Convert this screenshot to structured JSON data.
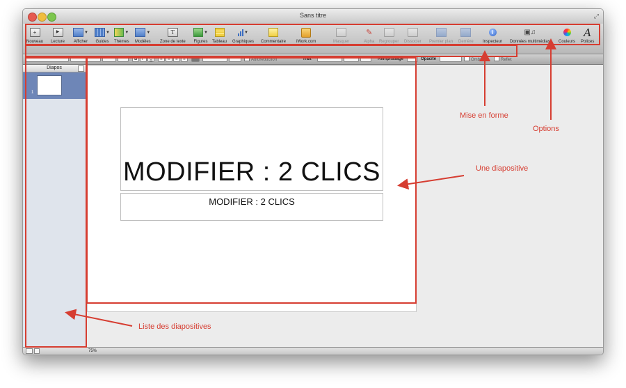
{
  "window": {
    "title": "Sans titre"
  },
  "toolbar": {
    "items": [
      {
        "label": "Nouveau",
        "icon": "plus-icon",
        "glyph": "+"
      },
      {
        "label": "Lecture",
        "icon": "play-icon",
        "glyph": "▶"
      },
      {
        "label": "Afficher",
        "icon": "view-icon"
      },
      {
        "label": "Guides",
        "icon": "guides-icon"
      },
      {
        "label": "Thèmes",
        "icon": "themes-icon"
      },
      {
        "label": "Modèles",
        "icon": "templates-icon"
      },
      {
        "label": "Zone de texte",
        "icon": "textbox-icon",
        "glyph": "T"
      },
      {
        "label": "Figures",
        "icon": "shapes-icon"
      },
      {
        "label": "Tableau",
        "icon": "table-icon"
      },
      {
        "label": "Graphiques",
        "icon": "chart-icon"
      },
      {
        "label": "Commentaire",
        "icon": "comment-icon"
      },
      {
        "label": "iWork.com",
        "icon": "iwork-icon"
      },
      {
        "label": "Masquer",
        "icon": "hide-icon"
      },
      {
        "label": "Alpha",
        "icon": "alpha-icon"
      },
      {
        "label": "Regrouper",
        "icon": "group-icon"
      },
      {
        "label": "Dissocier",
        "icon": "ungroup-icon"
      },
      {
        "label": "Premier plan",
        "icon": "front-icon"
      },
      {
        "label": "Derrière",
        "icon": "back-icon"
      },
      {
        "label": "Inspecteur",
        "icon": "info-icon",
        "glyph": "i"
      },
      {
        "label": "Données multimédias",
        "icon": "media-icon"
      },
      {
        "label": "Couleurs",
        "icon": "color-wheel-icon"
      },
      {
        "label": "Polices",
        "icon": "font-icon",
        "glyph": "A"
      }
    ]
  },
  "formatbar": {
    "bold": "B",
    "italic": "I",
    "underline": "U",
    "autoreduction_label": "Autoréduction",
    "trait_label": "Trait",
    "remplissage_label": "Remplissage",
    "opacite_label": "Opacité",
    "ombre_label": "Ombre",
    "reflet_label": "Reflet"
  },
  "sidebar": {
    "header": "Diapos",
    "slide_number": "1"
  },
  "slide": {
    "title": "MODIFIER : 2 CLICS",
    "subtitle": "MODIFIER : 2 CLICS"
  },
  "statusbar": {
    "zoom": "75%"
  },
  "annotations": {
    "mise_en_forme": "Mise en forme",
    "options": "Options",
    "une_diapositive": "Une diapositive",
    "liste_diapositives": "Liste des diapositives"
  },
  "colors": {
    "annotation_red": "#d63d31",
    "selected_slide": "#6e86b7",
    "sidebar_bg": "#dfe4ec"
  }
}
